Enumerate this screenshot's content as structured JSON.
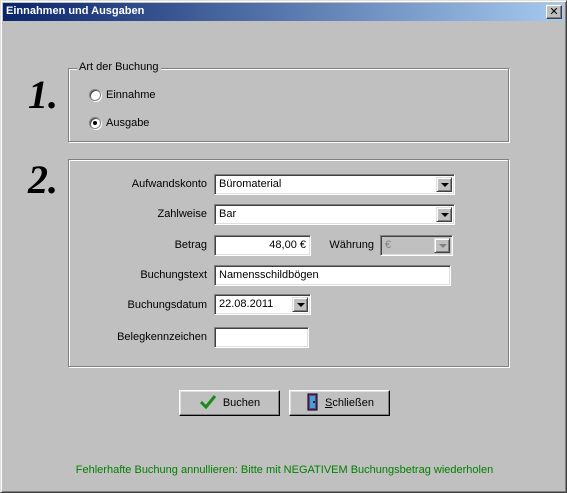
{
  "window": {
    "title": "Einnahmen und Ausgaben",
    "close_label": "✕"
  },
  "step1": {
    "number": "1.",
    "group_title": "Art der Buchung",
    "options": [
      {
        "label": "Einnahme",
        "checked": false
      },
      {
        "label": "Ausgabe",
        "checked": true
      }
    ]
  },
  "step2": {
    "number": "2.",
    "aufwandskonto": {
      "label": "Aufwandskonto",
      "value": "Büromaterial"
    },
    "zahlweise": {
      "label": "Zahlweise",
      "value": "Bar"
    },
    "betrag": {
      "label": "Betrag",
      "value": "48,00 €"
    },
    "waehrung": {
      "label": "Währung",
      "value": "€"
    },
    "buchungstext": {
      "label": "Buchungstext",
      "value": "Namensschildbögen"
    },
    "buchungsdatum": {
      "label": "Buchungsdatum",
      "value": "22.08.2011"
    },
    "belegkennzeichen": {
      "label": "Belegkennzeichen",
      "value": ""
    }
  },
  "buttons": {
    "buchen": {
      "label": "Buchen",
      "icon": "checkmark-icon"
    },
    "schliessen": {
      "label_first": "S",
      "label_rest": "chließen",
      "icon": "door-exit-icon"
    }
  },
  "status": {
    "hint": "Fehlerhafte Buchung annullieren: Bitte mit NEGATIVEM Buchungsbetrag wiederholen",
    "hint_color": "#008000"
  },
  "colors": {
    "titlebar_start": "#0a246a",
    "titlebar_end": "#a6caf0",
    "face": "#c0c0c0"
  }
}
